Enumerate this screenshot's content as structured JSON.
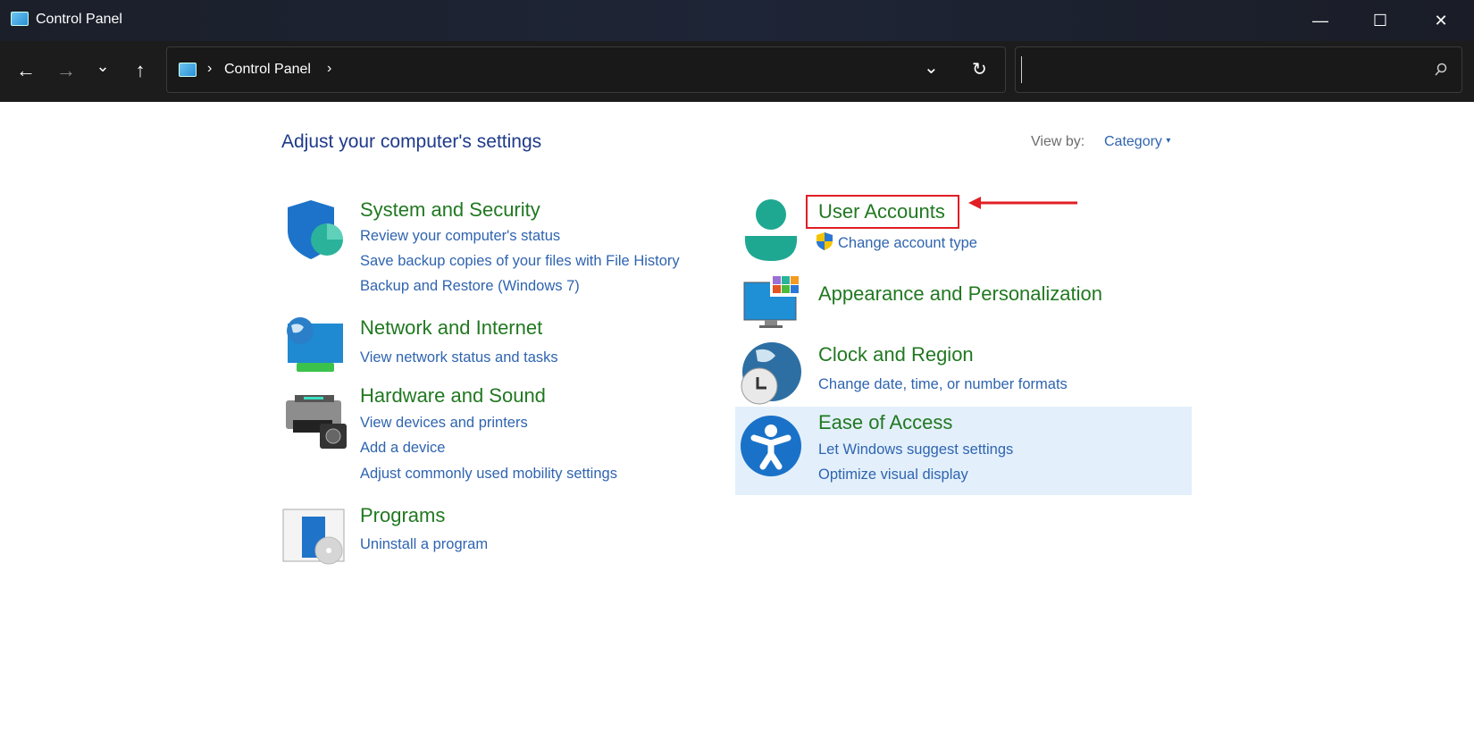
{
  "window": {
    "title": "Control Panel",
    "controls": {
      "minimize": "—",
      "maximize": "☐",
      "close": "✕"
    }
  },
  "toolbar": {
    "back": "←",
    "forward": "→",
    "recent": "⌄",
    "up": "↑",
    "breadcrumb": [
      "Control Panel"
    ],
    "separator": "›",
    "dropdown": "⌄",
    "refresh": "↻",
    "search": {
      "value": "",
      "placeholder": ""
    }
  },
  "main": {
    "heading": "Adjust your computer's settings",
    "view_by_label": "View by:",
    "view_by_value": "Category",
    "view_by_caret": "▾",
    "left": [
      {
        "title": "System and Security",
        "links": [
          "Review your computer's status",
          "Save backup copies of your files with File History",
          "Backup and Restore (Windows 7)"
        ]
      },
      {
        "title": "Network and Internet",
        "links": [
          "View network status and tasks"
        ]
      },
      {
        "title": "Hardware and Sound",
        "links": [
          "View devices and printers",
          "Add a device",
          "Adjust commonly used mobility settings"
        ]
      },
      {
        "title": "Programs",
        "links": [
          "Uninstall a program"
        ]
      }
    ],
    "right": [
      {
        "title": "User Accounts",
        "links": [
          "Change account type"
        ]
      },
      {
        "title": "Appearance and Personalization",
        "links": []
      },
      {
        "title": "Clock and Region",
        "links": [
          "Change date, time, or number formats"
        ]
      },
      {
        "title": "Ease of Access",
        "links": [
          "Let Windows suggest settings",
          "Optimize visual display"
        ]
      }
    ]
  },
  "annotation": {
    "color": "#e01e24"
  }
}
